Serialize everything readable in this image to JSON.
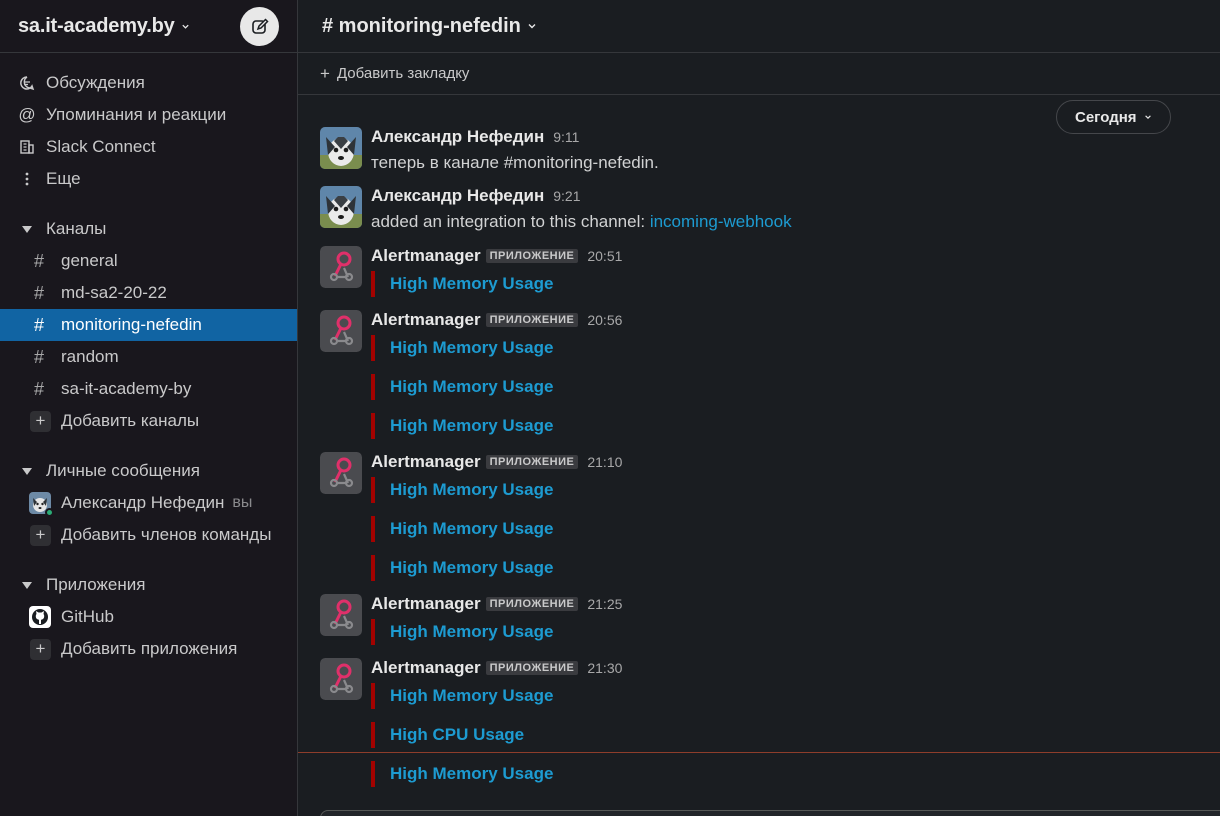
{
  "workspace": {
    "name": "sa.it-academy.by"
  },
  "nav": [
    {
      "label": "Обсуждения",
      "icon": "threads-icon"
    },
    {
      "label": "Упоминания и реакции",
      "icon": "at-icon"
    },
    {
      "label": "Slack Connect",
      "icon": "building-icon"
    },
    {
      "label": "Еще",
      "icon": "more-vertical-icon"
    }
  ],
  "channels_section": {
    "title": "Каналы",
    "items": [
      "general",
      "md-sa2-20-22",
      "monitoring-nefedin",
      "random",
      "sa-it-academy-by"
    ],
    "active": "monitoring-nefedin",
    "add_label": "Добавить каналы"
  },
  "dm_section": {
    "title": "Личные сообщения",
    "user": "Александр Нефедин",
    "you_label": "вы",
    "add_label": "Добавить членов команды"
  },
  "apps_section": {
    "title": "Приложения",
    "app": "GitHub",
    "add_label": "Добавить приложения"
  },
  "channel": {
    "title": "# monitoring-nefedin",
    "bookmark_label": "Добавить закладку",
    "date_divider": "Сегодня"
  },
  "messages": [
    {
      "author": "Александр Нефедин",
      "time": "9:11",
      "text": "теперь в канале #monitoring-nefedin."
    },
    {
      "author": "Александр Нефедин",
      "time": "9:21",
      "text": "added an integration to this channel: ",
      "link": "incoming-webhook"
    },
    {
      "author": "Alertmanager",
      "badge": "ПРИЛОЖЕНИЕ",
      "time": "20:51",
      "alerts": [
        "High Memory Usage"
      ]
    },
    {
      "author": "Alertmanager",
      "badge": "ПРИЛОЖЕНИЕ",
      "time": "20:56",
      "alerts": [
        "High Memory Usage",
        "High Memory Usage",
        "High Memory Usage"
      ]
    },
    {
      "author": "Alertmanager",
      "badge": "ПРИЛОЖЕНИЕ",
      "time": "21:10",
      "alerts": [
        "High Memory Usage",
        "High Memory Usage",
        "High Memory Usage"
      ]
    },
    {
      "author": "Alertmanager",
      "badge": "ПРИЛОЖЕНИЕ",
      "time": "21:25",
      "alerts": [
        "High Memory Usage"
      ]
    },
    {
      "author": "Alertmanager",
      "badge": "ПРИЛОЖЕНИЕ",
      "time": "21:30",
      "alerts": [
        "High Memory Usage",
        "High CPU Usage",
        "High Memory Usage"
      ]
    }
  ],
  "colors": {
    "sidebar_bg": "#19171d",
    "active_channel": "#1164a3",
    "link": "#1d9bd1",
    "alert_bar": "#a30200",
    "presence": "#2bac76"
  }
}
